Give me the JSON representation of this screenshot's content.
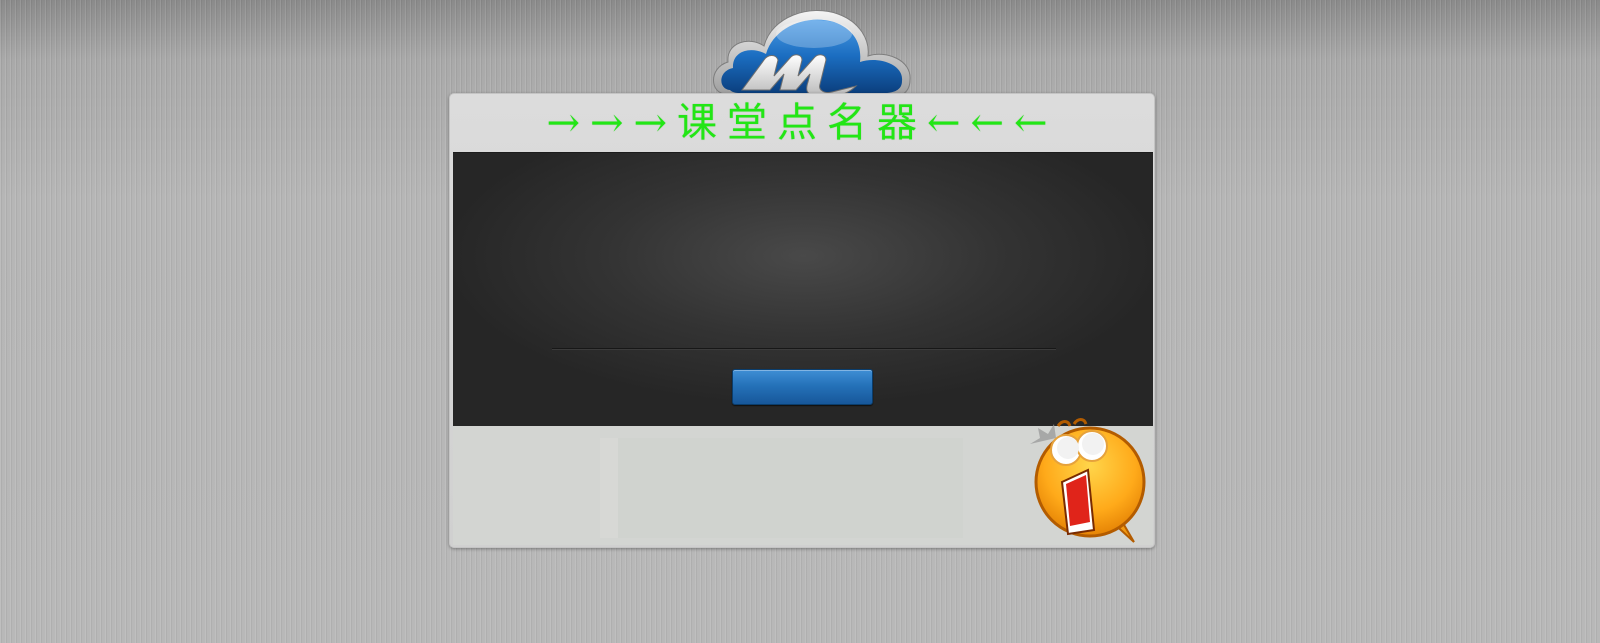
{
  "app": {
    "title": "→→→课堂点名器←←←",
    "logo_icon": "cloud-m-logo-icon",
    "mascot_icon": "shocked-face-icon"
  },
  "main": {
    "start_button_label": "",
    "result_text": ""
  },
  "colors": {
    "title": "#22e615",
    "screen": "#333333",
    "button": "#2572b9",
    "panel": "#d0d0d0",
    "background": "#b4b4b4"
  }
}
